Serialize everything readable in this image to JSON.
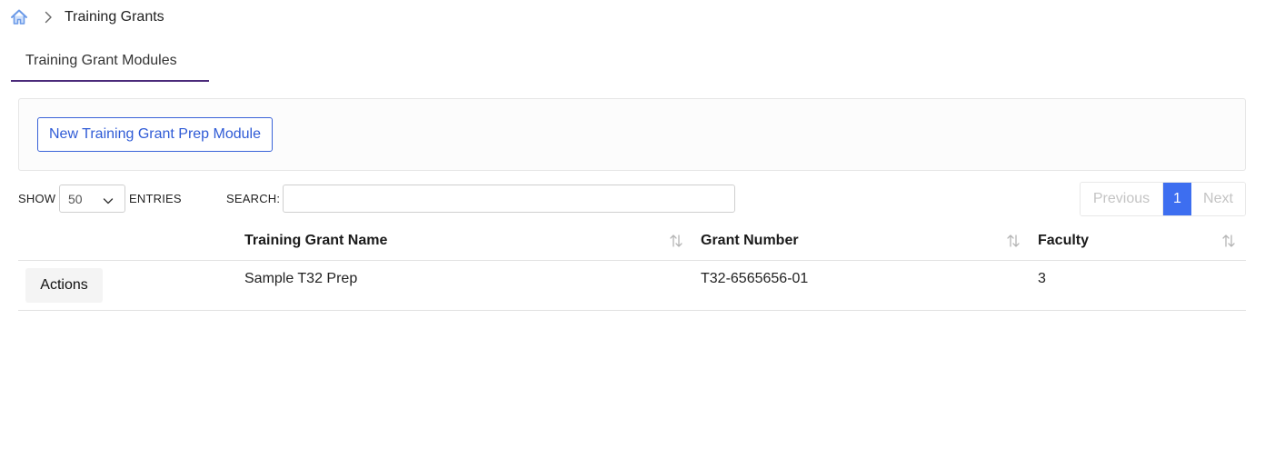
{
  "breadcrumb": {
    "home_icon": "home-icon",
    "separator_icon": "chevron-right-icon",
    "current": "Training Grants"
  },
  "tabs": [
    {
      "label": "Training Grant Modules",
      "active": true
    }
  ],
  "toolbar": {
    "new_button_label": "New Training Grant Prep Module"
  },
  "controls": {
    "show_label": "SHOW",
    "entries_value": "50",
    "entries_label": "ENTRIES",
    "search_label": "SEARCH:",
    "search_value": ""
  },
  "pagination": {
    "previous_label": "Previous",
    "current_page": "1",
    "next_label": "Next"
  },
  "table": {
    "columns": [
      "",
      "Training Grant Name",
      "Grant Number",
      "Faculty"
    ],
    "rows": [
      {
        "actions_label": "Actions",
        "name": "Sample T32 Prep",
        "grant_number": "T32-6565656-01",
        "faculty": "3"
      }
    ]
  },
  "colors": {
    "accent": "#3d6ef0",
    "link": "#2f5bd6",
    "tab_underline": "#4b2a7a",
    "home_icon": "#6b9ae8"
  }
}
